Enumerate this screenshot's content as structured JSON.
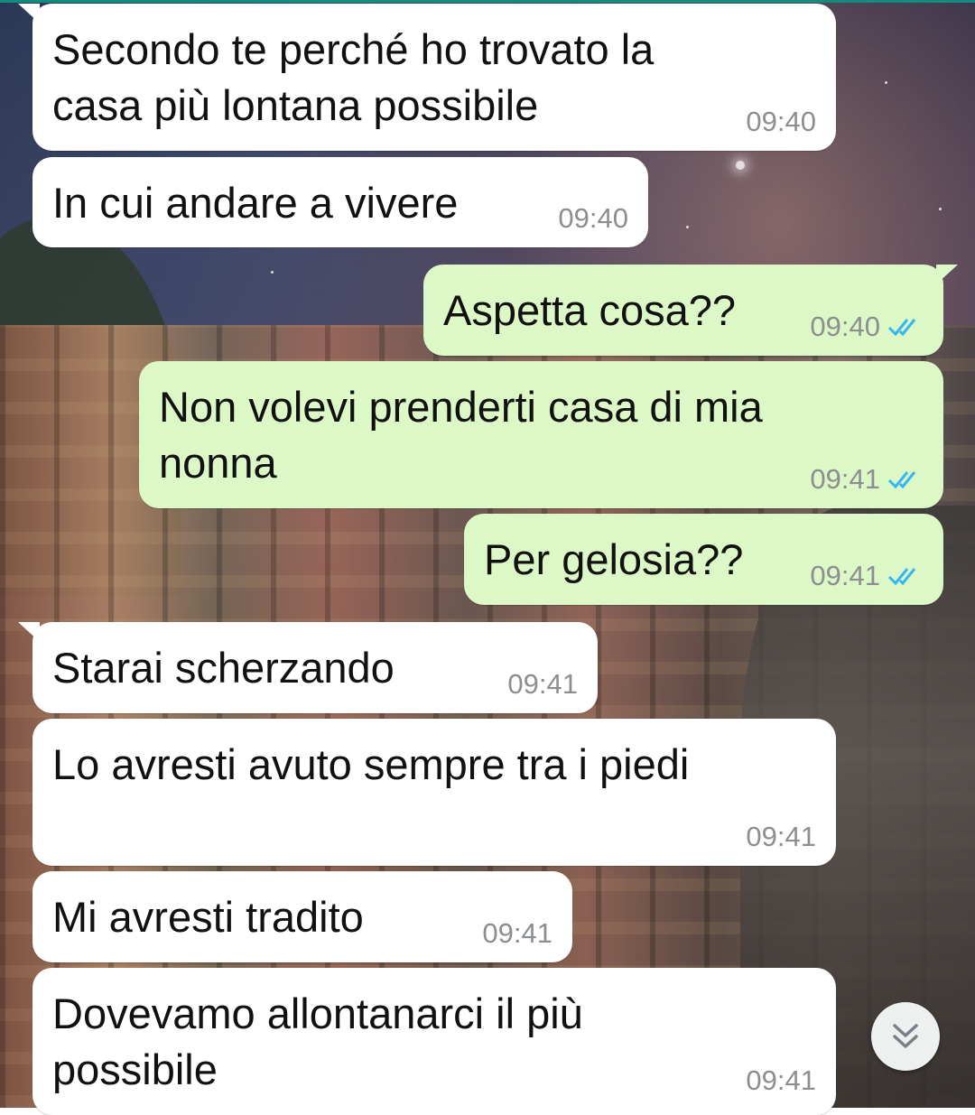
{
  "messages": [
    {
      "direction": "incoming",
      "text": "Secondo te perché ho trovato la\ncasa più lontana possibile",
      "time": "09:40"
    },
    {
      "direction": "incoming",
      "text": "In cui andare a vivere",
      "time": "09:40"
    },
    {
      "direction": "outgoing",
      "text": "Aspetta cosa??",
      "time": "09:40",
      "status": "read"
    },
    {
      "direction": "outgoing",
      "text": "Non volevi prenderti casa di mia\nnonna",
      "time": "09:41",
      "status": "read"
    },
    {
      "direction": "outgoing",
      "text": "Per gelosia??",
      "time": "09:41",
      "status": "read"
    },
    {
      "direction": "incoming",
      "text": "Starai scherzando",
      "time": "09:41"
    },
    {
      "direction": "incoming",
      "text": "Lo avresti avuto sempre tra i piedi",
      "time": "09:41"
    },
    {
      "direction": "incoming",
      "text": "Mi avresti tradito",
      "time": "09:41"
    },
    {
      "direction": "incoming",
      "text": "Dovevamo allontanarci il più\npossibile",
      "time": "09:41"
    }
  ],
  "icons": {
    "read_receipt": "double-check-icon",
    "scroll_down": "double-chevron-down-icon"
  },
  "colors": {
    "incoming_bubble": "#ffffff",
    "outgoing_bubble": "#dcf8c6",
    "read_tick": "#34b7f1",
    "timestamp": "#8b8f92"
  }
}
